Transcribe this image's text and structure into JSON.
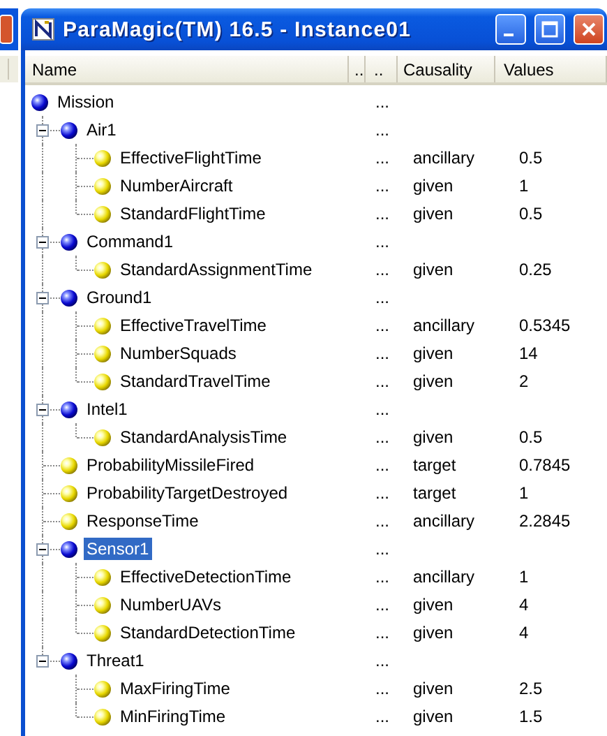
{
  "window": {
    "title": "ParaMagic(TM) 16.5 - Instance01"
  },
  "columns": [
    {
      "label": "Name"
    },
    {
      "label": ".."
    },
    {
      "label": ".."
    },
    {
      "label": "Causality"
    },
    {
      "label": "Values"
    }
  ],
  "tree": [
    {
      "name": "Mission",
      "kind": "block",
      "ellipsis": "...",
      "selected": false,
      "children": [
        {
          "name": "Air1",
          "kind": "block",
          "ellipsis": "...",
          "expanded": true,
          "selected": false,
          "children": [
            {
              "name": "EffectiveFlightTime",
              "kind": "variable",
              "ellipsis": "...",
              "causality": "ancillary",
              "value": "0.5",
              "selected": false
            },
            {
              "name": "NumberAircraft",
              "kind": "variable",
              "ellipsis": "...",
              "causality": "given",
              "value": "1",
              "selected": false
            },
            {
              "name": "StandardFlightTime",
              "kind": "variable",
              "ellipsis": "...",
              "causality": "given",
              "value": "0.5",
              "selected": false
            }
          ]
        },
        {
          "name": "Command1",
          "kind": "block",
          "ellipsis": "...",
          "expanded": true,
          "selected": false,
          "children": [
            {
              "name": "StandardAssignmentTime",
              "kind": "variable",
              "ellipsis": "...",
              "causality": "given",
              "value": "0.25",
              "selected": false
            }
          ]
        },
        {
          "name": "Ground1",
          "kind": "block",
          "ellipsis": "...",
          "expanded": true,
          "selected": false,
          "children": [
            {
              "name": "EffectiveTravelTime",
              "kind": "variable",
              "ellipsis": "...",
              "causality": "ancillary",
              "value": "0.5345",
              "selected": false
            },
            {
              "name": "NumberSquads",
              "kind": "variable",
              "ellipsis": "...",
              "causality": "given",
              "value": "14",
              "selected": false
            },
            {
              "name": "StandardTravelTime",
              "kind": "variable",
              "ellipsis": "...",
              "causality": "given",
              "value": "2",
              "selected": false
            }
          ]
        },
        {
          "name": "Intel1",
          "kind": "block",
          "ellipsis": "...",
          "expanded": true,
          "selected": false,
          "children": [
            {
              "name": "StandardAnalysisTime",
              "kind": "variable",
              "ellipsis": "...",
              "causality": "given",
              "value": "0.5",
              "selected": false
            }
          ]
        },
        {
          "name": "ProbabilityMissileFired",
          "kind": "variable",
          "ellipsis": "...",
          "causality": "target",
          "value": "0.7845",
          "selected": false
        },
        {
          "name": "ProbabilityTargetDestroyed",
          "kind": "variable",
          "ellipsis": "...",
          "causality": "target",
          "value": "1",
          "selected": false
        },
        {
          "name": "ResponseTime",
          "kind": "variable",
          "ellipsis": "...",
          "causality": "ancillary",
          "value": "2.2845",
          "selected": false
        },
        {
          "name": "Sensor1",
          "kind": "block",
          "ellipsis": "...",
          "expanded": true,
          "selected": true,
          "children": [
            {
              "name": "EffectiveDetectionTime",
              "kind": "variable",
              "ellipsis": "...",
              "causality": "ancillary",
              "value": "1",
              "selected": false
            },
            {
              "name": "NumberUAVs",
              "kind": "variable",
              "ellipsis": "...",
              "causality": "given",
              "value": "4",
              "selected": false
            },
            {
              "name": "StandardDetectionTime",
              "kind": "variable",
              "ellipsis": "...",
              "causality": "given",
              "value": "4",
              "selected": false
            }
          ]
        },
        {
          "name": "Threat1",
          "kind": "block",
          "ellipsis": "...",
          "expanded": true,
          "selected": false,
          "children": [
            {
              "name": "MaxFiringTime",
              "kind": "variable",
              "ellipsis": "...",
              "causality": "given",
              "value": "2.5",
              "selected": false
            },
            {
              "name": "MinFiringTime",
              "kind": "variable",
              "ellipsis": "...",
              "causality": "given",
              "value": "1.5",
              "selected": false
            }
          ]
        }
      ]
    }
  ]
}
